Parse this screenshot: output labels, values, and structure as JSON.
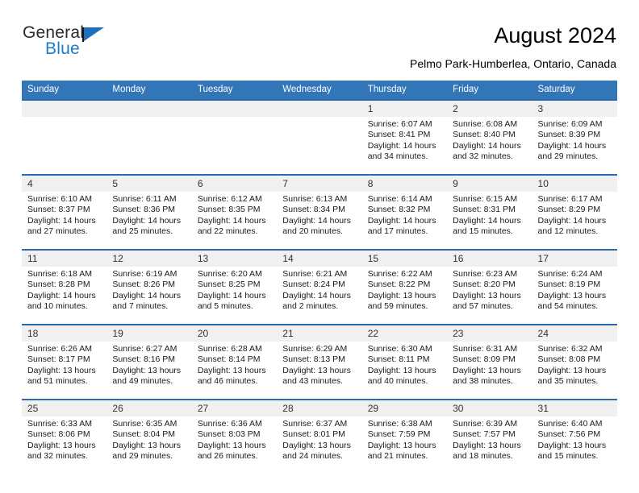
{
  "brand": {
    "name_part1": "General",
    "name_part2": "Blue",
    "triangle_color": "#1f6fba",
    "blue": "#1f7ac4"
  },
  "header": {
    "title": "August 2024",
    "subtitle": "Pelmo Park-Humberlea, Ontario, Canada",
    "header_bg": "#3376b8",
    "daynum_bg": "#f0f0f0",
    "rule_color": "#2a6aad"
  },
  "weekdays": [
    "Sunday",
    "Monday",
    "Tuesday",
    "Wednesday",
    "Thursday",
    "Friday",
    "Saturday"
  ],
  "weeks": [
    [
      {
        "day": "",
        "lines": []
      },
      {
        "day": "",
        "lines": []
      },
      {
        "day": "",
        "lines": []
      },
      {
        "day": "",
        "lines": []
      },
      {
        "day": "1",
        "lines": [
          "Sunrise: 6:07 AM",
          "Sunset: 8:41 PM",
          "Daylight: 14 hours",
          "and 34 minutes."
        ]
      },
      {
        "day": "2",
        "lines": [
          "Sunrise: 6:08 AM",
          "Sunset: 8:40 PM",
          "Daylight: 14 hours",
          "and 32 minutes."
        ]
      },
      {
        "day": "3",
        "lines": [
          "Sunrise: 6:09 AM",
          "Sunset: 8:39 PM",
          "Daylight: 14 hours",
          "and 29 minutes."
        ]
      }
    ],
    [
      {
        "day": "4",
        "lines": [
          "Sunrise: 6:10 AM",
          "Sunset: 8:37 PM",
          "Daylight: 14 hours",
          "and 27 minutes."
        ]
      },
      {
        "day": "5",
        "lines": [
          "Sunrise: 6:11 AM",
          "Sunset: 8:36 PM",
          "Daylight: 14 hours",
          "and 25 minutes."
        ]
      },
      {
        "day": "6",
        "lines": [
          "Sunrise: 6:12 AM",
          "Sunset: 8:35 PM",
          "Daylight: 14 hours",
          "and 22 minutes."
        ]
      },
      {
        "day": "7",
        "lines": [
          "Sunrise: 6:13 AM",
          "Sunset: 8:34 PM",
          "Daylight: 14 hours",
          "and 20 minutes."
        ]
      },
      {
        "day": "8",
        "lines": [
          "Sunrise: 6:14 AM",
          "Sunset: 8:32 PM",
          "Daylight: 14 hours",
          "and 17 minutes."
        ]
      },
      {
        "day": "9",
        "lines": [
          "Sunrise: 6:15 AM",
          "Sunset: 8:31 PM",
          "Daylight: 14 hours",
          "and 15 minutes."
        ]
      },
      {
        "day": "10",
        "lines": [
          "Sunrise: 6:17 AM",
          "Sunset: 8:29 PM",
          "Daylight: 14 hours",
          "and 12 minutes."
        ]
      }
    ],
    [
      {
        "day": "11",
        "lines": [
          "Sunrise: 6:18 AM",
          "Sunset: 8:28 PM",
          "Daylight: 14 hours",
          "and 10 minutes."
        ]
      },
      {
        "day": "12",
        "lines": [
          "Sunrise: 6:19 AM",
          "Sunset: 8:26 PM",
          "Daylight: 14 hours",
          "and 7 minutes."
        ]
      },
      {
        "day": "13",
        "lines": [
          "Sunrise: 6:20 AM",
          "Sunset: 8:25 PM",
          "Daylight: 14 hours",
          "and 5 minutes."
        ]
      },
      {
        "day": "14",
        "lines": [
          "Sunrise: 6:21 AM",
          "Sunset: 8:24 PM",
          "Daylight: 14 hours",
          "and 2 minutes."
        ]
      },
      {
        "day": "15",
        "lines": [
          "Sunrise: 6:22 AM",
          "Sunset: 8:22 PM",
          "Daylight: 13 hours",
          "and 59 minutes."
        ]
      },
      {
        "day": "16",
        "lines": [
          "Sunrise: 6:23 AM",
          "Sunset: 8:20 PM",
          "Daylight: 13 hours",
          "and 57 minutes."
        ]
      },
      {
        "day": "17",
        "lines": [
          "Sunrise: 6:24 AM",
          "Sunset: 8:19 PM",
          "Daylight: 13 hours",
          "and 54 minutes."
        ]
      }
    ],
    [
      {
        "day": "18",
        "lines": [
          "Sunrise: 6:26 AM",
          "Sunset: 8:17 PM",
          "Daylight: 13 hours",
          "and 51 minutes."
        ]
      },
      {
        "day": "19",
        "lines": [
          "Sunrise: 6:27 AM",
          "Sunset: 8:16 PM",
          "Daylight: 13 hours",
          "and 49 minutes."
        ]
      },
      {
        "day": "20",
        "lines": [
          "Sunrise: 6:28 AM",
          "Sunset: 8:14 PM",
          "Daylight: 13 hours",
          "and 46 minutes."
        ]
      },
      {
        "day": "21",
        "lines": [
          "Sunrise: 6:29 AM",
          "Sunset: 8:13 PM",
          "Daylight: 13 hours",
          "and 43 minutes."
        ]
      },
      {
        "day": "22",
        "lines": [
          "Sunrise: 6:30 AM",
          "Sunset: 8:11 PM",
          "Daylight: 13 hours",
          "and 40 minutes."
        ]
      },
      {
        "day": "23",
        "lines": [
          "Sunrise: 6:31 AM",
          "Sunset: 8:09 PM",
          "Daylight: 13 hours",
          "and 38 minutes."
        ]
      },
      {
        "day": "24",
        "lines": [
          "Sunrise: 6:32 AM",
          "Sunset: 8:08 PM",
          "Daylight: 13 hours",
          "and 35 minutes."
        ]
      }
    ],
    [
      {
        "day": "25",
        "lines": [
          "Sunrise: 6:33 AM",
          "Sunset: 8:06 PM",
          "Daylight: 13 hours",
          "and 32 minutes."
        ]
      },
      {
        "day": "26",
        "lines": [
          "Sunrise: 6:35 AM",
          "Sunset: 8:04 PM",
          "Daylight: 13 hours",
          "and 29 minutes."
        ]
      },
      {
        "day": "27",
        "lines": [
          "Sunrise: 6:36 AM",
          "Sunset: 8:03 PM",
          "Daylight: 13 hours",
          "and 26 minutes."
        ]
      },
      {
        "day": "28",
        "lines": [
          "Sunrise: 6:37 AM",
          "Sunset: 8:01 PM",
          "Daylight: 13 hours",
          "and 24 minutes."
        ]
      },
      {
        "day": "29",
        "lines": [
          "Sunrise: 6:38 AM",
          "Sunset: 7:59 PM",
          "Daylight: 13 hours",
          "and 21 minutes."
        ]
      },
      {
        "day": "30",
        "lines": [
          "Sunrise: 6:39 AM",
          "Sunset: 7:57 PM",
          "Daylight: 13 hours",
          "and 18 minutes."
        ]
      },
      {
        "day": "31",
        "lines": [
          "Sunrise: 6:40 AM",
          "Sunset: 7:56 PM",
          "Daylight: 13 hours",
          "and 15 minutes."
        ]
      }
    ]
  ]
}
